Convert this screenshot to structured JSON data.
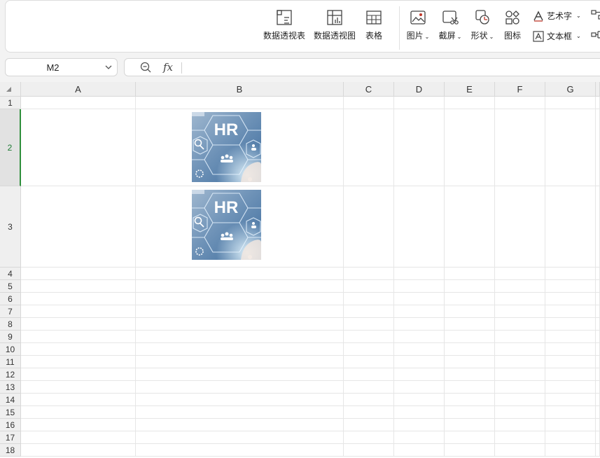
{
  "ribbon": {
    "pivot_table": "数据透视表",
    "pivot_chart": "数据透视图",
    "table": "表格",
    "picture": "图片",
    "screenshot": "截屏",
    "shapes": "形状",
    "icons": "图标",
    "wordart": "艺术字",
    "textbox": "文本框"
  },
  "formula_bar": {
    "cell_ref": "M2",
    "fx": "fx",
    "content": ""
  },
  "columns": [
    "A",
    "B",
    "C",
    "D",
    "E",
    "F",
    "G"
  ],
  "rows": [
    "1",
    "2",
    "3",
    "4",
    "5",
    "6",
    "7",
    "8",
    "9",
    "10",
    "11",
    "12",
    "13",
    "14",
    "15",
    "16",
    "17",
    "18"
  ],
  "selected_row": "2",
  "images": [
    {
      "text": "HR",
      "row": "2",
      "column": "B"
    },
    {
      "text": "HR",
      "row": "3",
      "column": "B"
    }
  ],
  "colors": {
    "selection": "#2f8f3c",
    "accent_green": "#1e7a33"
  }
}
